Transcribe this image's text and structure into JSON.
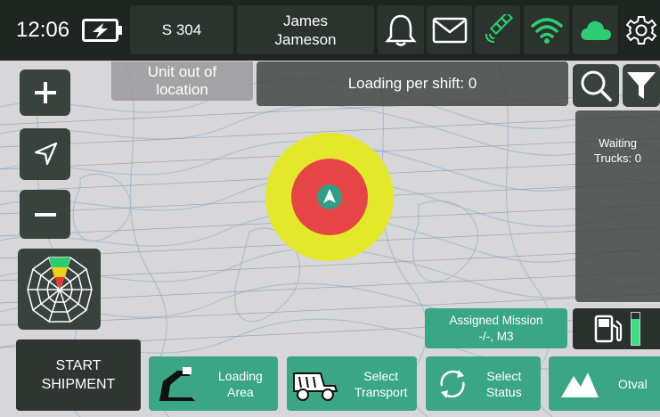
{
  "header": {
    "time": "12:06",
    "unit_id": "S 304",
    "operator_first": "James",
    "operator_last": "Jameson"
  },
  "status": {
    "unit_location": "Unit out of location",
    "loading_per_shift": "Loading per shift: 0",
    "waiting_trucks_label": "Waiting",
    "waiting_trucks_count": "Trucks: 0"
  },
  "mission": {
    "title": "Assigned Mission",
    "value": "-/-, M3"
  },
  "actions": {
    "start_line1": "START",
    "start_line2": "SHIPMENT",
    "loading_area_1": "Loading",
    "loading_area_2": "Area",
    "select_transport_1": "Select",
    "select_transport_2": "Transport",
    "select_status_1": "Select",
    "select_status_2": "Status",
    "otval": "Otval"
  },
  "icons": [
    "battery-charging-icon",
    "bell-icon",
    "mail-icon",
    "satellite-icon",
    "wifi-icon",
    "cloud-icon",
    "gear-icon",
    "zoom-in-icon",
    "navigate-icon",
    "zoom-out-icon",
    "search-icon",
    "filter-icon",
    "fuel-icon",
    "excavator-icon",
    "dump-truck-icon",
    "refresh-icon",
    "mountain-icon"
  ],
  "colors": {
    "accent": "#3aa685",
    "topbar": "#1f2521",
    "zone_outer": "#e3e82a",
    "zone_inner": "#e64545",
    "signal_green": "#2ecc71",
    "fuel_level": "#3ddc84"
  },
  "fuel_level_fraction": 0.8
}
